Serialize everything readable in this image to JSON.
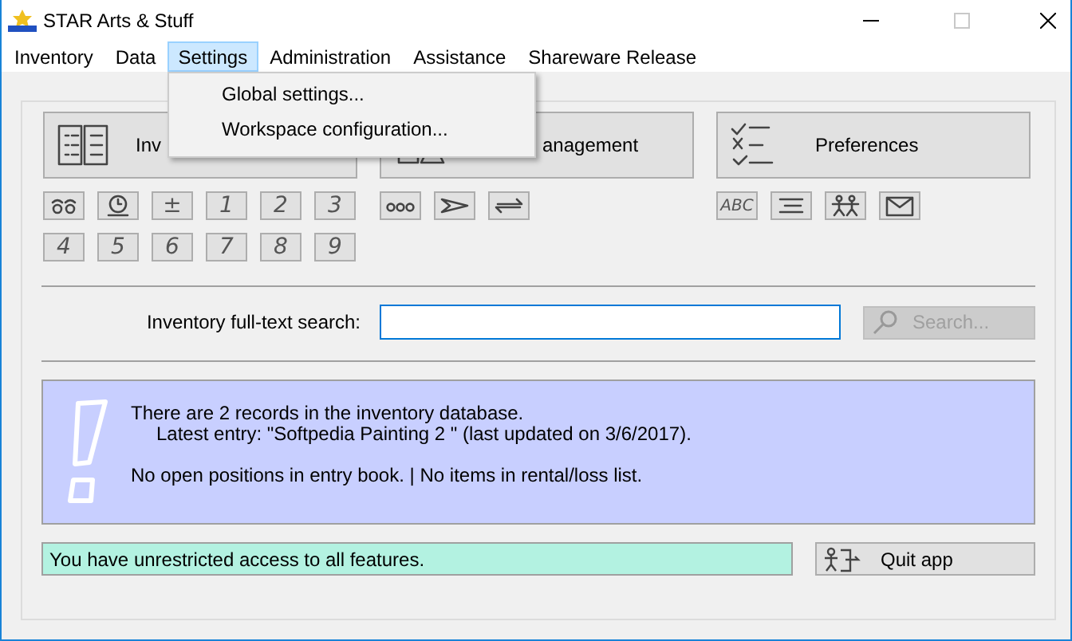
{
  "window": {
    "title": "STAR Arts & Stuff",
    "maximize_disabled": true
  },
  "menu": [
    {
      "label": "Inventory",
      "selected": false
    },
    {
      "label": "Data",
      "selected": false
    },
    {
      "label": "Settings",
      "selected": true
    },
    {
      "label": "Administration",
      "selected": false
    },
    {
      "label": "Assistance",
      "selected": false
    },
    {
      "label": "Shareware Release",
      "selected": false
    }
  ],
  "dropdown": [
    "Global settings...",
    "Workspace configuration..."
  ],
  "groups": [
    {
      "kind": "book",
      "label": "Inv",
      "tools": [
        {
          "kind": "eyes"
        },
        {
          "kind": "clock"
        },
        {
          "kind": "text",
          "label": "±"
        },
        {
          "kind": "text",
          "label": "1"
        },
        {
          "kind": "text",
          "label": "2"
        },
        {
          "kind": "text",
          "label": "3"
        },
        {
          "kind": "text",
          "label": "4"
        },
        {
          "kind": "text",
          "label": "5"
        },
        {
          "kind": "text",
          "label": "6"
        },
        {
          "kind": "text",
          "label": "7"
        },
        {
          "kind": "text",
          "label": "8"
        },
        {
          "kind": "text",
          "label": "9"
        }
      ]
    },
    {
      "kind": "shapes",
      "label": "anagement",
      "tools": [
        {
          "kind": "dots"
        },
        {
          "kind": "send"
        },
        {
          "kind": "swap"
        }
      ]
    },
    {
      "kind": "checklist",
      "label": "Preferences",
      "tools": [
        {
          "kind": "text",
          "label": "ABC"
        },
        {
          "kind": "lines"
        },
        {
          "kind": "people"
        },
        {
          "kind": "mail"
        }
      ]
    }
  ],
  "search": {
    "label": "Inventory full-text search:",
    "button": "Search...",
    "button_disabled": true
  },
  "info": {
    "lines": [
      {
        "kind": "plain",
        "text": "There are 2 records in the inventory database."
      },
      {
        "kind": "indent",
        "text": "Latest entry: \"Softpedia Painting 2 \" (last updated on 3/6/2017)."
      },
      {
        "kind": "gap",
        "text": "No open positions in entry book. | No items in rental/loss list."
      }
    ]
  },
  "status": "You have unrestricted access to all features.",
  "quit": "Quit app"
}
